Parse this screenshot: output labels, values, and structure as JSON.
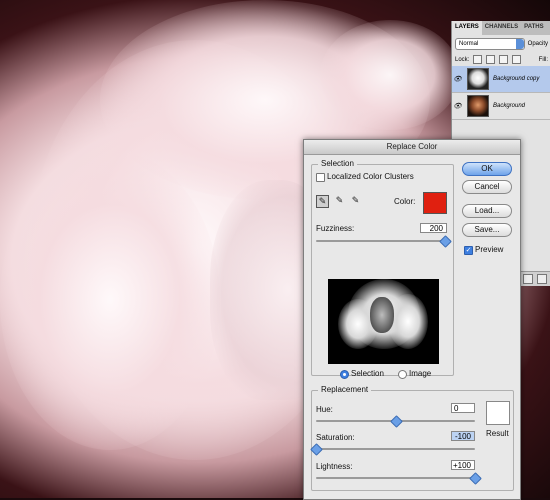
{
  "layers_panel": {
    "tabs": [
      "LAYERS",
      "CHANNELS",
      "PATHS"
    ],
    "active_tab": "LAYERS",
    "blend_mode": "Normal",
    "opacity_label": "Opacity",
    "lock_label": "Lock:",
    "fill_label": "Fill:",
    "layers": [
      {
        "name": "Background copy",
        "selected": true,
        "visible": true
      },
      {
        "name": "Background",
        "selected": false,
        "visible": true
      }
    ]
  },
  "dialog": {
    "title": "Replace Color",
    "selection": {
      "legend": "Selection",
      "localized_clusters_label": "Localized Color Clusters",
      "localized_clusters_checked": false,
      "color_label": "Color:",
      "color": "#e02010",
      "fuzziness_label": "Fuzziness:",
      "fuzziness_value": "200",
      "fuzziness_level": 1.0,
      "view_options": [
        "Selection",
        "Image"
      ],
      "view_selected": "Selection"
    },
    "buttons": {
      "ok": "OK",
      "cancel": "Cancel",
      "load": "Load...",
      "save": "Save..."
    },
    "preview_label": "Preview",
    "preview_checked": true,
    "replacement": {
      "legend": "Replacement",
      "hue_label": "Hue:",
      "hue_value": "0",
      "hue_level": 0.5,
      "saturation_label": "Saturation:",
      "saturation_value": "-100",
      "saturation_level": 0.0,
      "lightness_label": "Lightness:",
      "lightness_value": "+100",
      "lightness_level": 1.0,
      "result_label": "Result",
      "result_color": "#ffffff"
    }
  }
}
